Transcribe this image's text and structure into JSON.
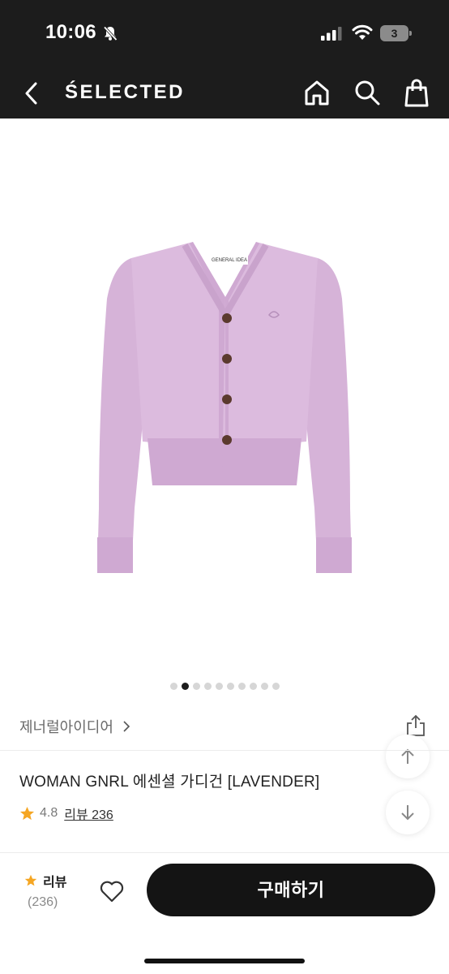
{
  "status_bar": {
    "time": "10:06",
    "battery": "3",
    "icons": [
      "bell-slash-icon",
      "signal-icon",
      "wifi-icon",
      "battery-icon"
    ]
  },
  "nav": {
    "title": "ŚELECTED",
    "icons": [
      "back-icon",
      "home-icon",
      "search-icon",
      "shopping-bag-icon"
    ]
  },
  "product": {
    "image_label": "GENERAL IDEA",
    "colors": {
      "garment": "#d6b3d8",
      "buttons": "#5b3a2e"
    },
    "carousel": {
      "total": 10,
      "current": 2
    },
    "brand": "제너럴아이디어",
    "title": "WOMAN GNRL 에센셜 가디건 [LAVENDER]",
    "rating": "4.8",
    "review_link": "리뷰 236"
  },
  "bottom_bar": {
    "review_label": "리뷰",
    "review_count": "(236)",
    "buy_label": "구매하기"
  },
  "colors": {
    "header_bg": "#1c1c1c",
    "star": "#f5a623",
    "buy_button_bg": "#141414"
  }
}
